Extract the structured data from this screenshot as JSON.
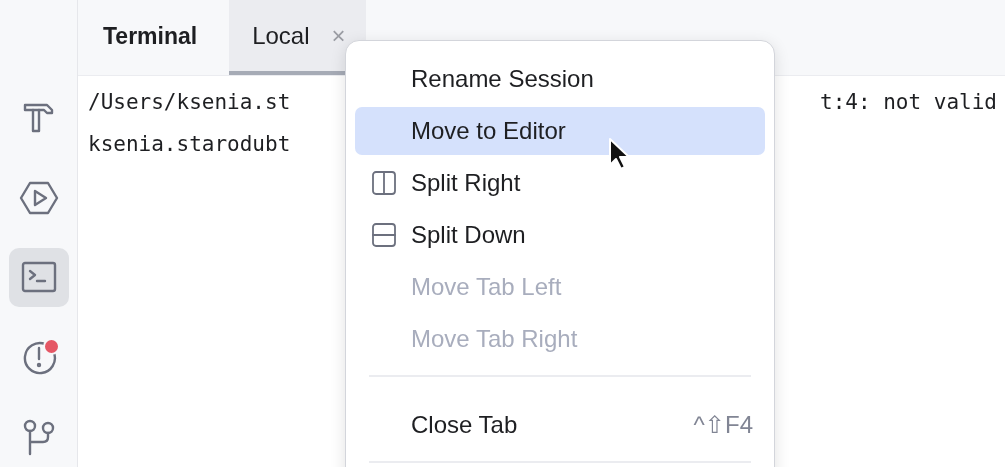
{
  "sidebar": {
    "items": [
      {
        "kind": "hammer",
        "selected": false,
        "badge": false
      },
      {
        "kind": "run",
        "selected": false,
        "badge": false
      },
      {
        "kind": "terminal",
        "selected": true,
        "badge": false
      },
      {
        "kind": "problems",
        "selected": false,
        "badge": true
      },
      {
        "kind": "git",
        "selected": false,
        "badge": false
      }
    ]
  },
  "panel_title": "Terminal",
  "tabs": [
    {
      "label": "Local",
      "selected": true,
      "close": "×"
    }
  ],
  "terminal_lines": [
    {
      "left": "/Users/ksenia.st",
      "right": "t:4: not valid"
    },
    {
      "left": "ksenia.starodubt"
    }
  ],
  "context_menu": {
    "items": [
      {
        "kind": "plain",
        "label": "Rename Session",
        "highlighted": false,
        "disabled": false
      },
      {
        "kind": "plain",
        "label": "Move to Editor",
        "highlighted": true,
        "disabled": false
      },
      {
        "kind": "split-right",
        "label": "Split Right",
        "highlighted": false,
        "disabled": false
      },
      {
        "kind": "split-down",
        "label": "Split Down",
        "highlighted": false,
        "disabled": false
      },
      {
        "kind": "plain",
        "label": "Move Tab Left",
        "highlighted": false,
        "disabled": true
      },
      {
        "kind": "plain",
        "label": "Move Tab Right",
        "highlighted": false,
        "disabled": true
      },
      {
        "kind": "separator"
      },
      {
        "kind": "plain",
        "label": "Close Tab",
        "highlighted": false,
        "disabled": false,
        "shortcut": "^⇧F4"
      },
      {
        "kind": "separator"
      }
    ]
  }
}
